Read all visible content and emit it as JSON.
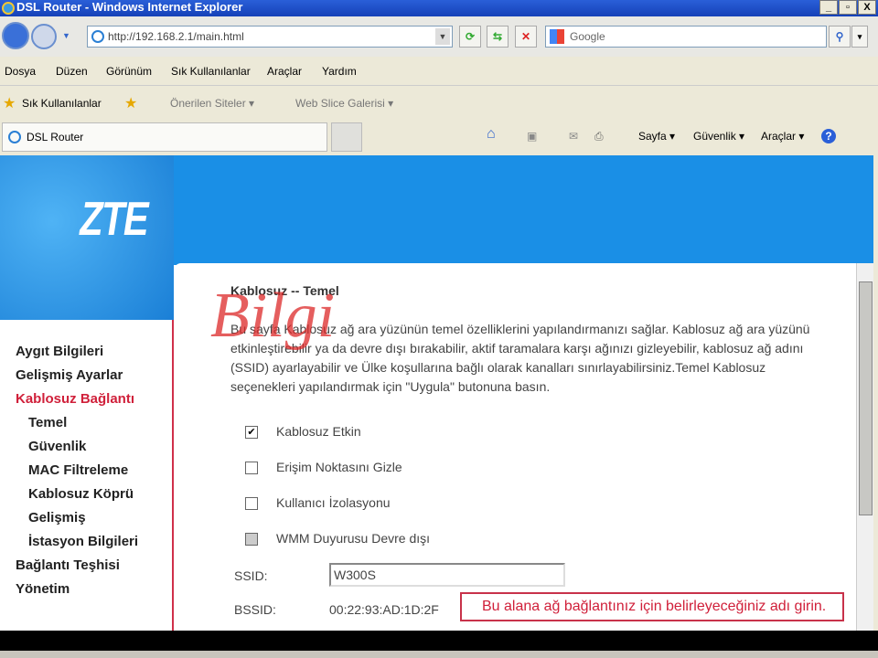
{
  "window": {
    "title": "DSL Router - Windows Internet Explorer",
    "min": "_",
    "max": "▫",
    "close": "X"
  },
  "nav": {
    "url": "http://192.168.2.1/main.html",
    "search_placeholder": "Google"
  },
  "menu": [
    "Dosya",
    "Düzen",
    "Görünüm",
    "Sık Kullanılanlar",
    "Araçlar",
    "Yardım"
  ],
  "favorites": {
    "label": "Sık Kullanılanlar",
    "suggested": "Önerilen Siteler ▾",
    "webslice": "Web Slice Galerisi ▾"
  },
  "tab": {
    "title": "DSL Router"
  },
  "tools": {
    "page": "Sayfa ▾",
    "safety": "Güvenlik ▾",
    "tools": "Araçlar ▾",
    "help": "?"
  },
  "router": {
    "logo": "ZTE",
    "sidebar": [
      "Aygıt Bilgileri",
      "Gelişmiş Ayarlar",
      "Kablosuz Bağlantı",
      "Temel",
      "Güvenlik",
      "MAC Filtreleme",
      "Kablosuz Köprü",
      "Gelişmiş",
      "İstasyon Bilgileri",
      "Bağlantı Teşhisi",
      "Yönetim"
    ],
    "heading": "Kablosuz -- Temel",
    "description": "Bu sayfa Kablosuz ağ ara yüzünün temel özelliklerini yapılandırmanızı sağlar. Kablosuz ağ ara yüzünü etkinleştirebilir ya da devre dışı bırakabilir, aktif taramalara karşı ağınızı gizleyebilir, kablosuz ağ adını (SSID) ayarlayabilir ve Ülke koşullarına bağlı olarak kanalları sınırlayabilirsiniz.Temel Kablosuz seçenekleri yapılandırmak için \"Uygula\" butonuna basın.",
    "checkboxes": [
      {
        "label": "Kablosuz Etkin",
        "checked": true
      },
      {
        "label": "Erişim Noktasını Gizle",
        "checked": false
      },
      {
        "label": "Kullanıcı İzolasyonu",
        "checked": false
      },
      {
        "label": "WMM Duyurusu Devre dışı",
        "checked": false
      }
    ],
    "ssid_label": "SSID:",
    "ssid_value": "W300S",
    "bssid_label": "BSSID:",
    "bssid_value": "00:22:93:AD:1D:2F",
    "tooltip": "Bu alana ağ bağlantınız için belirleyeceğiniz adı girin.",
    "watermark": "Bilgi"
  }
}
